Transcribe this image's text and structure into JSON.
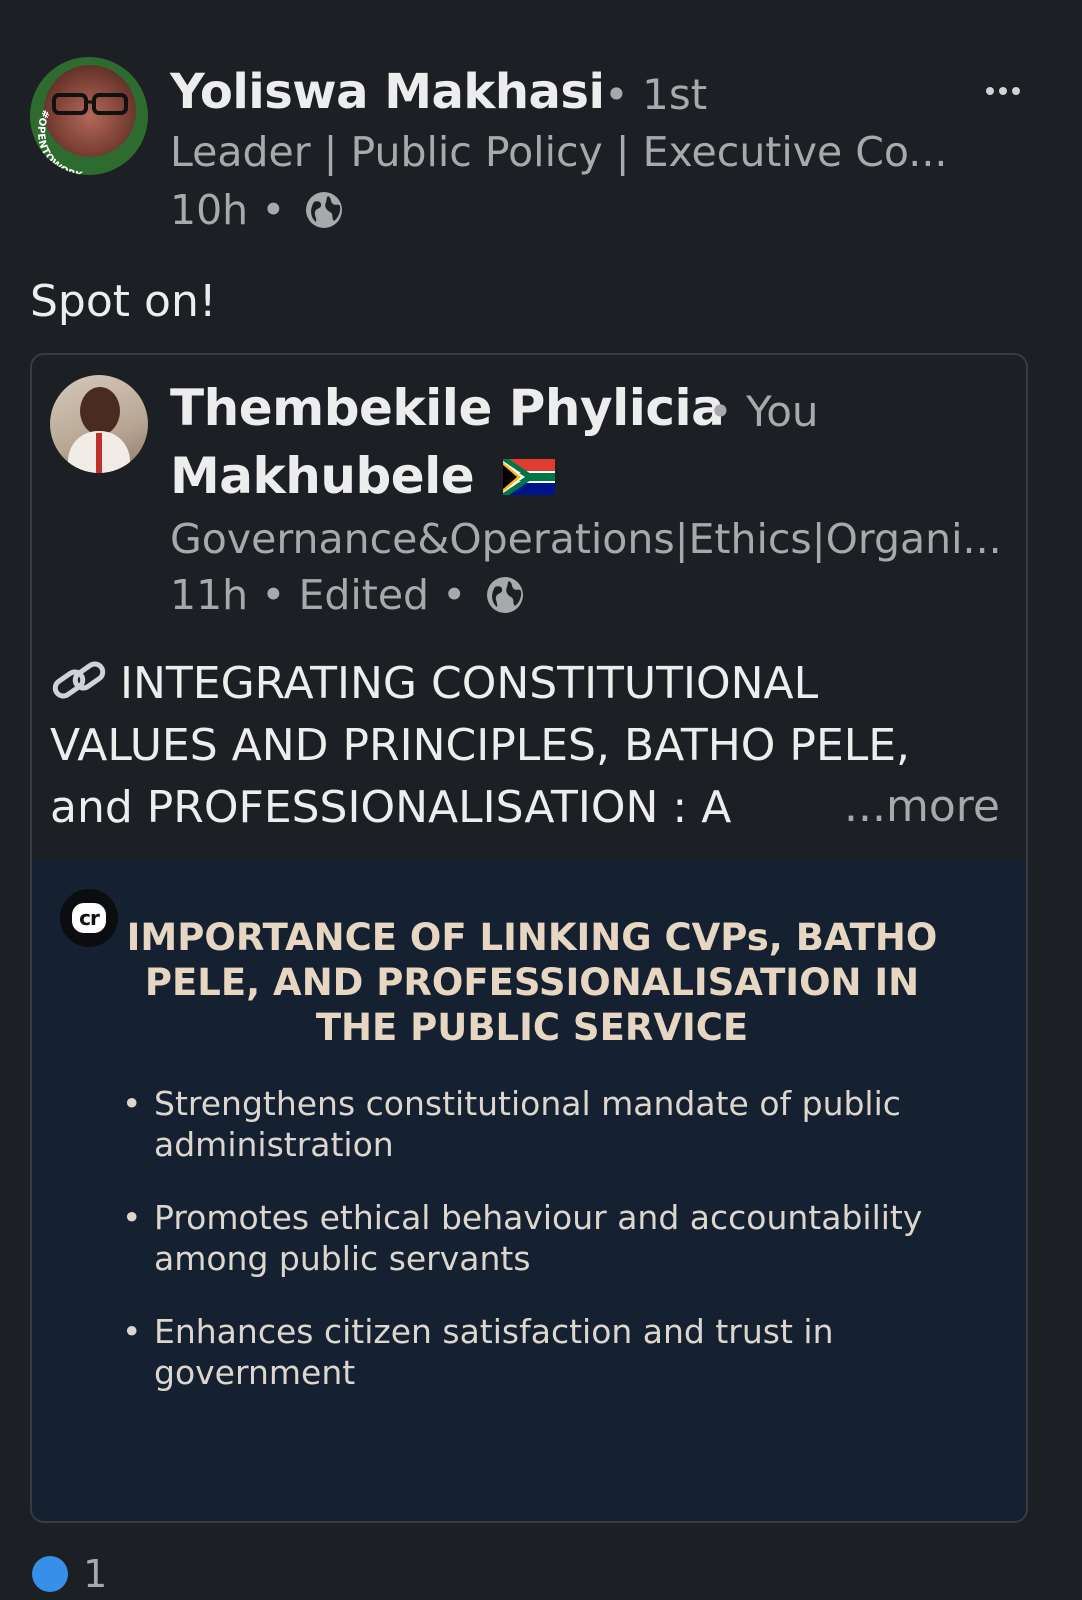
{
  "post": {
    "author_name": "Yoliswa Makhasi",
    "author_degree": "• 1st",
    "author_headline": "Leader | Public Policy | Executive Co...",
    "timestamp": "10h",
    "meta_separator": "•",
    "commentary": "Spot on!",
    "avatar_badge": "#OPENTOWORK",
    "more_icon": "ellipsis-icon",
    "visibility_icon": "globe-icon"
  },
  "shared_post": {
    "author_name_line1": "Thembekile Phylicia",
    "author_name_line2": "Makhubele",
    "relation": "• You",
    "flag_icon": "south-africa-flag-icon",
    "author_headline": "Governance&Operations|Ethics|Organi...",
    "timestamp": "11h",
    "edited": "Edited",
    "meta_separator": "•",
    "text_line1": "INTEGRATING CONSTITUTIONAL",
    "text_line2": "VALUES AND PRINCIPLES, BATHO PELE,",
    "text_line3": "and PROFESSIONALISATION : A",
    "more_label": "...more",
    "text_icon": "link-icon"
  },
  "document": {
    "logo_text": "cr",
    "title_line1": "IMPORTANCE OF LINKING CVPs, BATHO",
    "title_line2": "PELE, AND PROFESSIONALISATION IN",
    "title_line3": "THE PUBLIC SERVICE",
    "bullets": [
      {
        "line1": "Strengthens constitutional mandate of public",
        "line2": "administration"
      },
      {
        "line1": "Promotes ethical behaviour and accountability",
        "line2": "among public servants"
      },
      {
        "line1": "Enhances citizen satisfaction and trust in",
        "line2": "government"
      }
    ],
    "title_color": "#e7d7c2",
    "background_color": "#152131"
  },
  "reactions": {
    "count": "1",
    "icon": "like-icon"
  },
  "theme": {
    "background": "#1c1f23",
    "primary_text": "#ededed",
    "secondary_text": "#a7a9ab",
    "open_to_work_green": "#2e6b2f",
    "like_blue": "#378fe9"
  }
}
